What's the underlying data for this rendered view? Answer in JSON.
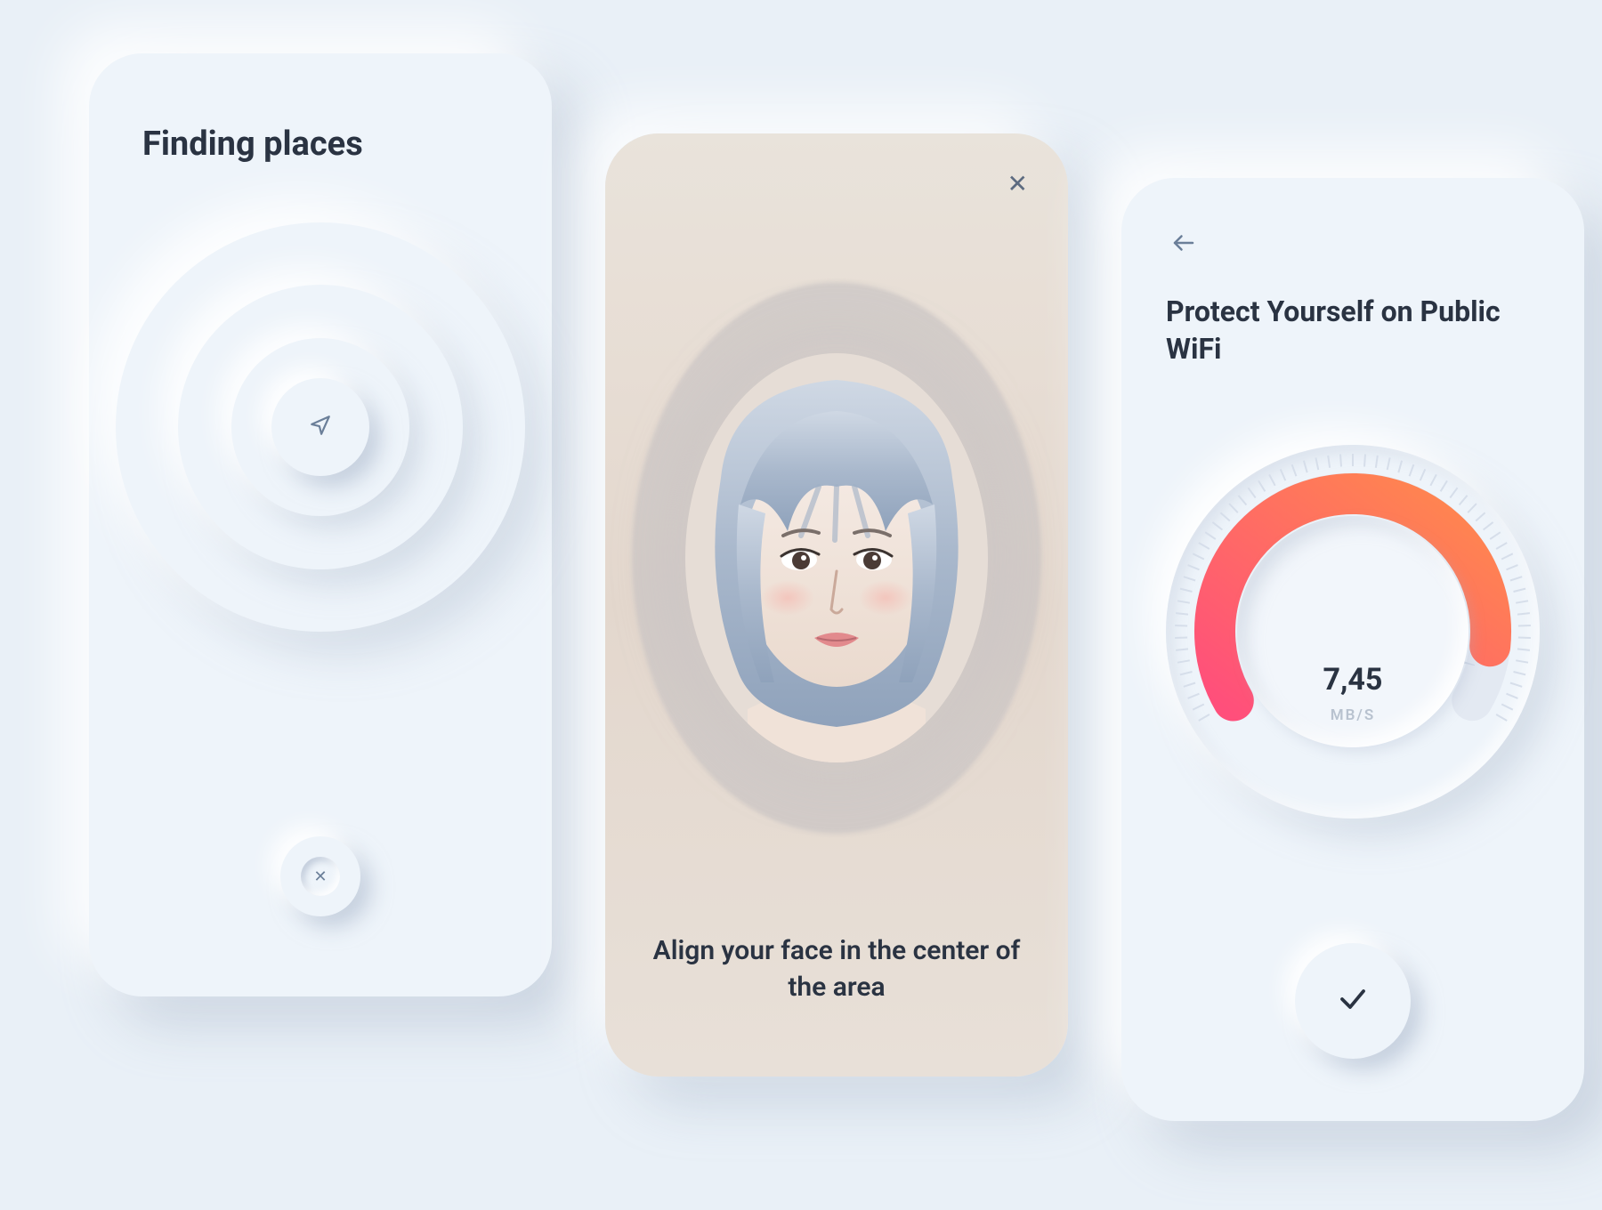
{
  "places": {
    "title": "Finding places",
    "locate_icon": "location-arrow",
    "cancel_icon": "close"
  },
  "face": {
    "close_icon": "close",
    "caption": "Align your face in the center of the area"
  },
  "wifi": {
    "back_icon": "arrow-left",
    "title": "Protect Yourself on Public WiFi",
    "speed_value": "7,45",
    "speed_unit": "MB/S",
    "confirm_icon": "check"
  },
  "chart_data": {
    "type": "gauge",
    "title": "Protect Yourself on Public WiFi",
    "value": 7.45,
    "unit": "MB/S",
    "min": 0,
    "max": 10,
    "arc_start_deg": -210,
    "arc_end_deg": 30,
    "needle_deg": 15,
    "fill_fraction": 0.9,
    "gradient": [
      "#ff4f7b",
      "#ff8a4c"
    ],
    "ticks": 60
  }
}
